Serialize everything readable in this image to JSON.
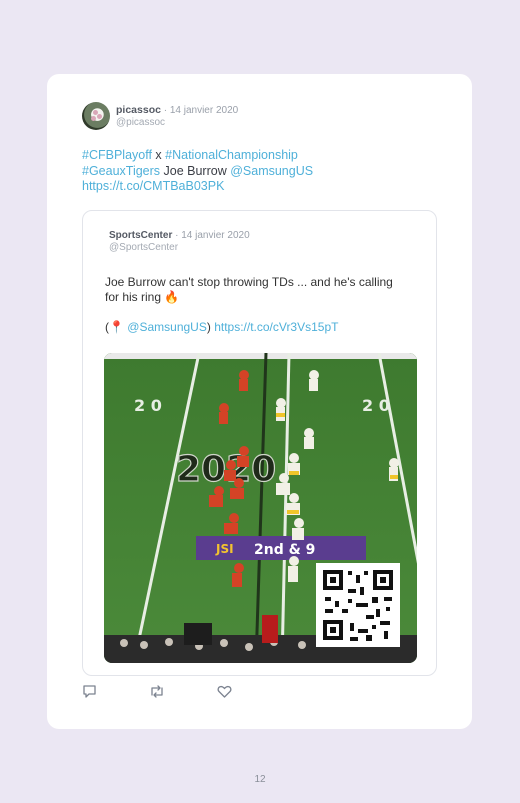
{
  "tweet": {
    "author_name": "picassoc",
    "date": " · 14 janvier 2020",
    "handle": "@picassoc",
    "text_parts": {
      "h1": "#CFBPlayoff",
      "x": " x ",
      "h2": "#NationalChampionship",
      "h3": "#GeauxTigers",
      "mid": " Joe Burrow ",
      "mention": "@SamsungUS",
      "url": "https://t.co/CMTBaB03PK"
    }
  },
  "quoted": {
    "author_name": "SportsCenter",
    "date": " · 14 janvier 2020",
    "handle": "@SportsCenter",
    "line1": "Joe Burrow can't stop throwing TDs ... and he's calling for his ring 🔥",
    "open": "(",
    "pin": "📍",
    "mention": "@SamsungUS",
    "close": ") ",
    "url": "https://t.co/cVr3Vs15pT"
  },
  "media": {
    "field_numbers": [
      "2 0",
      "2 0"
    ],
    "midfield_logo": "2020",
    "scoreboard": "2nd & 9",
    "banner_left": "JSI",
    "qr_label": "QR code"
  },
  "actions": {
    "reply_icon": "reply-icon",
    "retweet_icon": "retweet-icon",
    "like_icon": "heart-icon"
  },
  "page_number": "12"
}
